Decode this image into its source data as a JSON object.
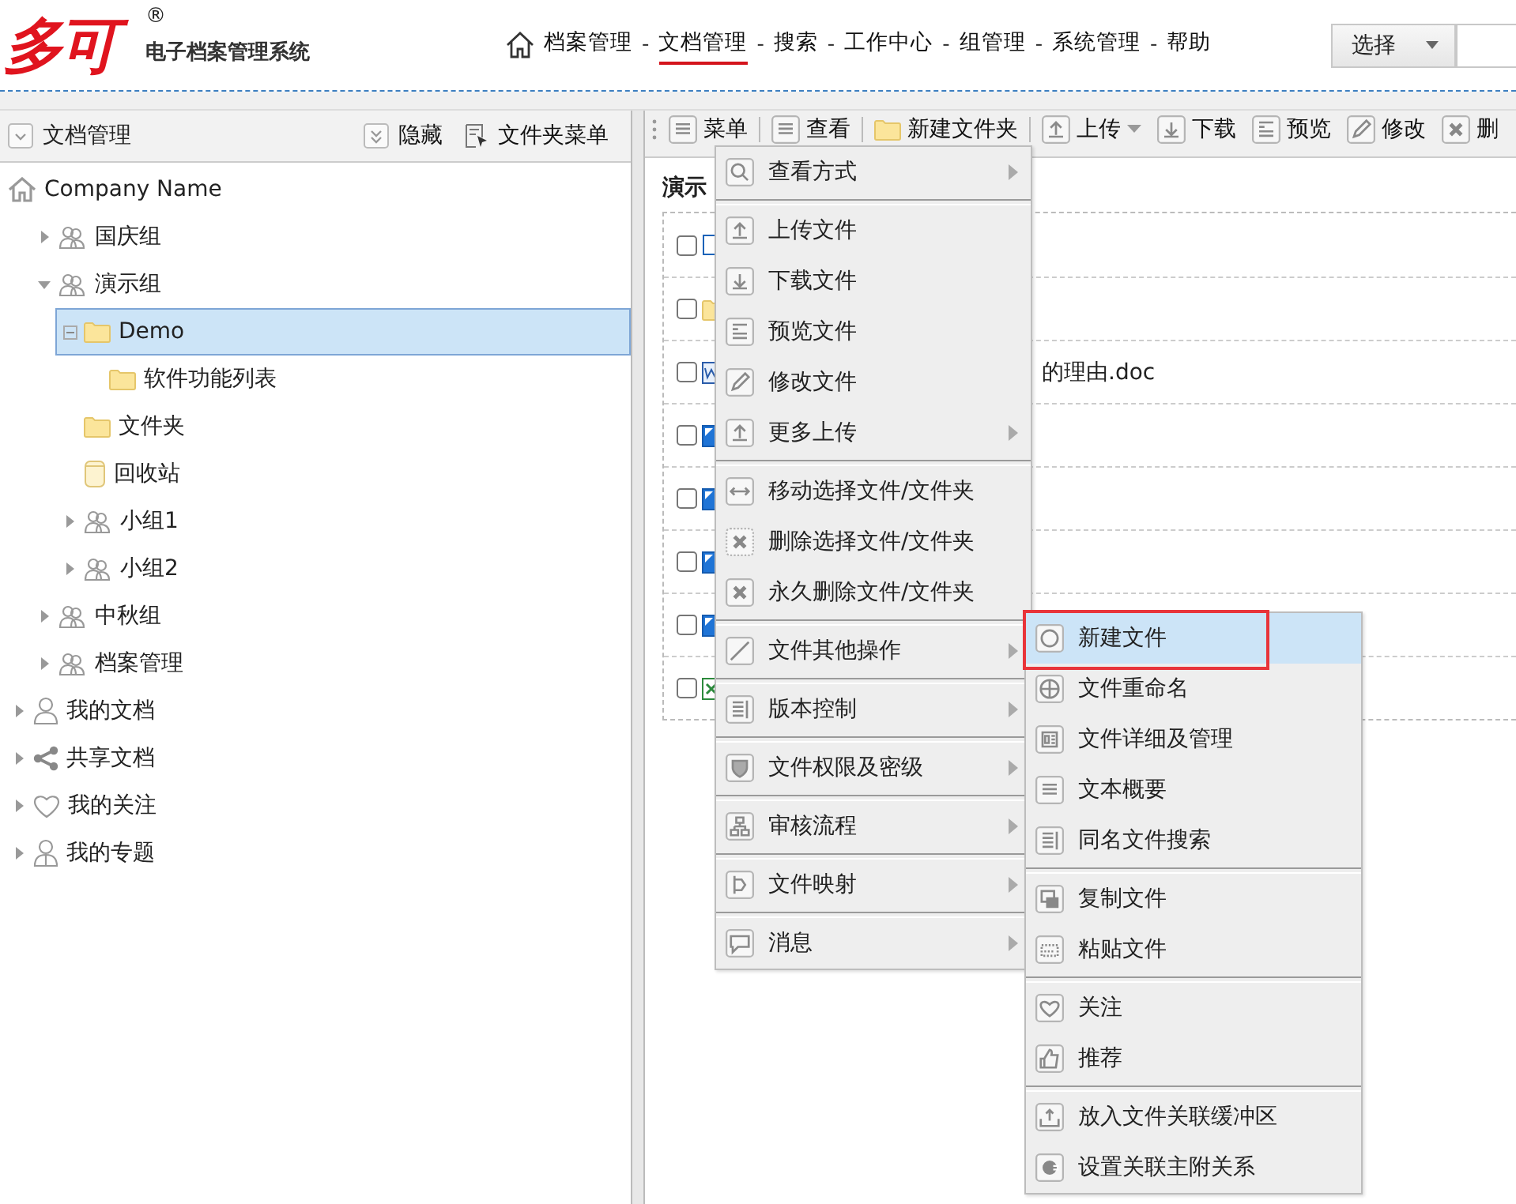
{
  "header": {
    "logo": {
      "mark": "多可",
      "registered": "®",
      "subtitle": "电子档案管理系统"
    },
    "nav": {
      "separator": "-",
      "items": [
        {
          "label": "档案管理",
          "selected": false
        },
        {
          "label": "文档管理",
          "selected": true
        },
        {
          "label": "搜索",
          "selected": false
        },
        {
          "label": "工作中心",
          "selected": false
        },
        {
          "label": "组管理",
          "selected": false
        },
        {
          "label": "系统管理",
          "selected": false
        },
        {
          "label": "帮助",
          "selected": false
        }
      ]
    },
    "select": {
      "label": "选择"
    }
  },
  "sidebar": {
    "title": "文档管理",
    "actions": [
      "隐藏",
      "文件夹菜单"
    ],
    "tree": [
      {
        "label": "Company Name",
        "kind": "home",
        "selected": false,
        "children": [
          {
            "label": "国庆组",
            "kind": "group",
            "expanded": false,
            "selected": false
          },
          {
            "label": "演示组",
            "kind": "group",
            "expanded": true,
            "selected": false,
            "children": [
              {
                "label": "Demo",
                "kind": "folder",
                "expanded": true,
                "selected": true,
                "children": [
                  {
                    "label": "软件功能列表",
                    "kind": "folder",
                    "selected": false
                  }
                ]
              },
              {
                "label": "文件夹",
                "kind": "folder",
                "selected": false
              },
              {
                "label": "回收站",
                "kind": "bin",
                "selected": false
              },
              {
                "label": "小组1",
                "kind": "group",
                "expanded": false,
                "selected": false
              },
              {
                "label": "小组2",
                "kind": "group",
                "expanded": false,
                "selected": false
              }
            ]
          },
          {
            "label": "中秋组",
            "kind": "group",
            "expanded": false,
            "selected": false
          },
          {
            "label": "档案管理",
            "kind": "group",
            "expanded": false,
            "selected": false
          }
        ]
      },
      {
        "label": "我的文档",
        "kind": "user",
        "expanded": false,
        "selected": false
      },
      {
        "label": "共享文档",
        "kind": "share",
        "expanded": false,
        "selected": false
      },
      {
        "label": "我的关注",
        "kind": "heart",
        "expanded": false,
        "selected": false
      },
      {
        "label": "我的专题",
        "kind": "person",
        "expanded": false,
        "selected": false
      }
    ]
  },
  "toolbar": [
    {
      "label": "菜单",
      "dropdown": false
    },
    {
      "label": "查看",
      "dropdown": false
    },
    {
      "label": "新建文件夹",
      "dropdown": false
    },
    {
      "label": "上传",
      "dropdown": true
    },
    {
      "label": "下载",
      "dropdown": false
    },
    {
      "label": "预览",
      "dropdown": false
    },
    {
      "label": "修改",
      "dropdown": false
    },
    {
      "label": "删",
      "dropdown": false
    }
  ],
  "breadcrumb": "演示",
  "files": [
    {
      "kind": "link",
      "checked": false
    },
    {
      "kind": "folder",
      "checked": false
    },
    {
      "kind": "doc",
      "name": "的理由.doc",
      "covered": true,
      "checked": false
    },
    {
      "kind": "image",
      "checked": false
    },
    {
      "kind": "image",
      "checked": false
    },
    {
      "kind": "image",
      "checked": false
    },
    {
      "kind": "image",
      "checked": false
    },
    {
      "kind": "sheet",
      "checked": false
    }
  ],
  "context_menu": [
    [
      {
        "label": "查看方式",
        "submenu": true,
        "selected": false
      }
    ],
    [
      {
        "label": "上传文件",
        "submenu": false,
        "selected": false
      },
      {
        "label": "下载文件",
        "submenu": false,
        "selected": false
      },
      {
        "label": "预览文件",
        "submenu": false,
        "selected": false
      },
      {
        "label": "修改文件",
        "submenu": false,
        "selected": false
      },
      {
        "label": "更多上传",
        "submenu": true,
        "selected": false
      }
    ],
    [
      {
        "label": "移动选择文件/文件夹",
        "submenu": false,
        "selected": false
      },
      {
        "label": "删除选择文件/文件夹",
        "submenu": false,
        "selected": false
      },
      {
        "label": "永久删除文件/文件夹",
        "submenu": false,
        "selected": false
      }
    ],
    [
      {
        "label": "文件其他操作",
        "submenu": true,
        "selected": false
      }
    ],
    [
      {
        "label": "版本控制",
        "submenu": true,
        "selected": false
      }
    ],
    [
      {
        "label": "文件权限及密级",
        "submenu": true,
        "selected": false
      }
    ],
    [
      {
        "label": "审核流程",
        "submenu": true,
        "selected": false
      }
    ],
    [
      {
        "label": "文件映射",
        "submenu": true,
        "selected": false
      }
    ],
    [
      {
        "label": "消息",
        "submenu": true,
        "selected": false
      }
    ]
  ],
  "submenu": [
    [
      {
        "label": "新建文件",
        "selected": true
      },
      {
        "label": "文件重命名",
        "selected": false
      },
      {
        "label": "文件详细及管理",
        "selected": false
      },
      {
        "label": "文本概要",
        "selected": false
      },
      {
        "label": "同名文件搜索",
        "selected": false
      }
    ],
    [
      {
        "label": "复制文件",
        "selected": false
      },
      {
        "label": "粘贴文件",
        "selected": false
      }
    ],
    [
      {
        "label": "关注",
        "selected": false
      },
      {
        "label": "推荐",
        "selected": false
      }
    ],
    [
      {
        "label": "放入文件关联缓冲区",
        "selected": false
      },
      {
        "label": "设置关联主附关系",
        "selected": false
      }
    ]
  ]
}
